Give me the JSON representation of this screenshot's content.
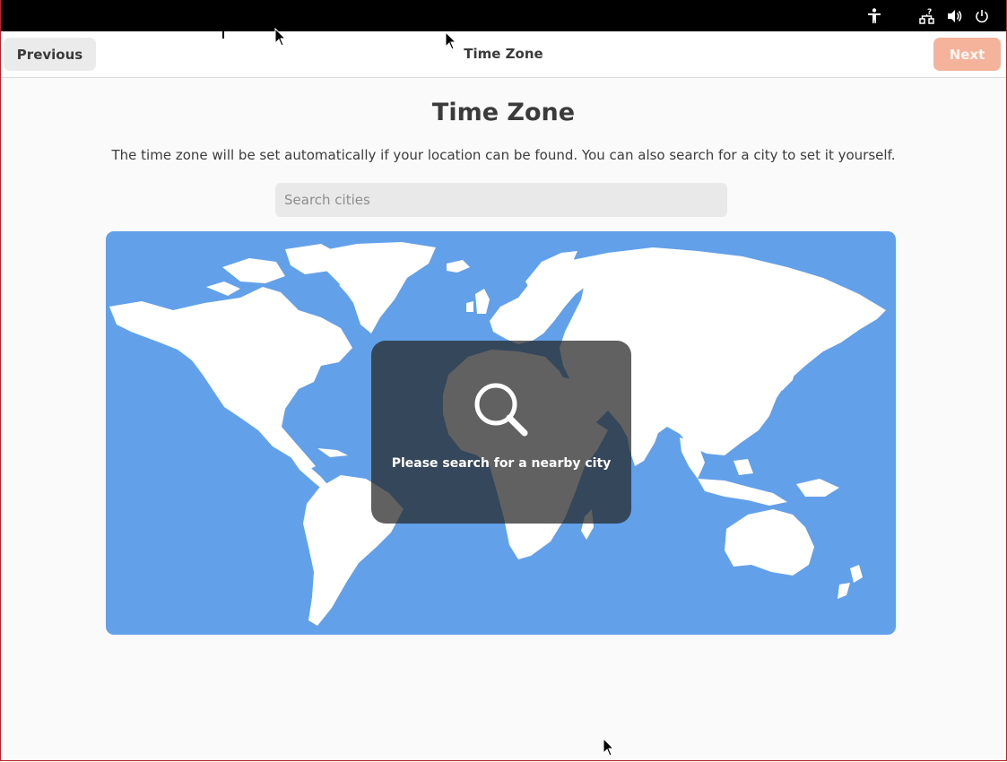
{
  "topbar": {
    "icons": [
      "accessibility-icon",
      "network-icon",
      "volume-icon",
      "power-icon"
    ]
  },
  "header": {
    "previous_label": "Previous",
    "title": "Time Zone",
    "next_label": "Next"
  },
  "main": {
    "title": "Time Zone",
    "description": "The time zone will be set automatically if your location can be found. You can also search for a city to set it yourself.",
    "search": {
      "placeholder": "Search cities",
      "value": ""
    },
    "map": {
      "overlay_text": "Please search for a nearby city",
      "overlay_icon": "search-icon"
    }
  },
  "colors": {
    "map_water": "#62a0ea",
    "land": "#ffffff",
    "next_button_disabled": "#f6b39c",
    "topbar": "#000000"
  }
}
